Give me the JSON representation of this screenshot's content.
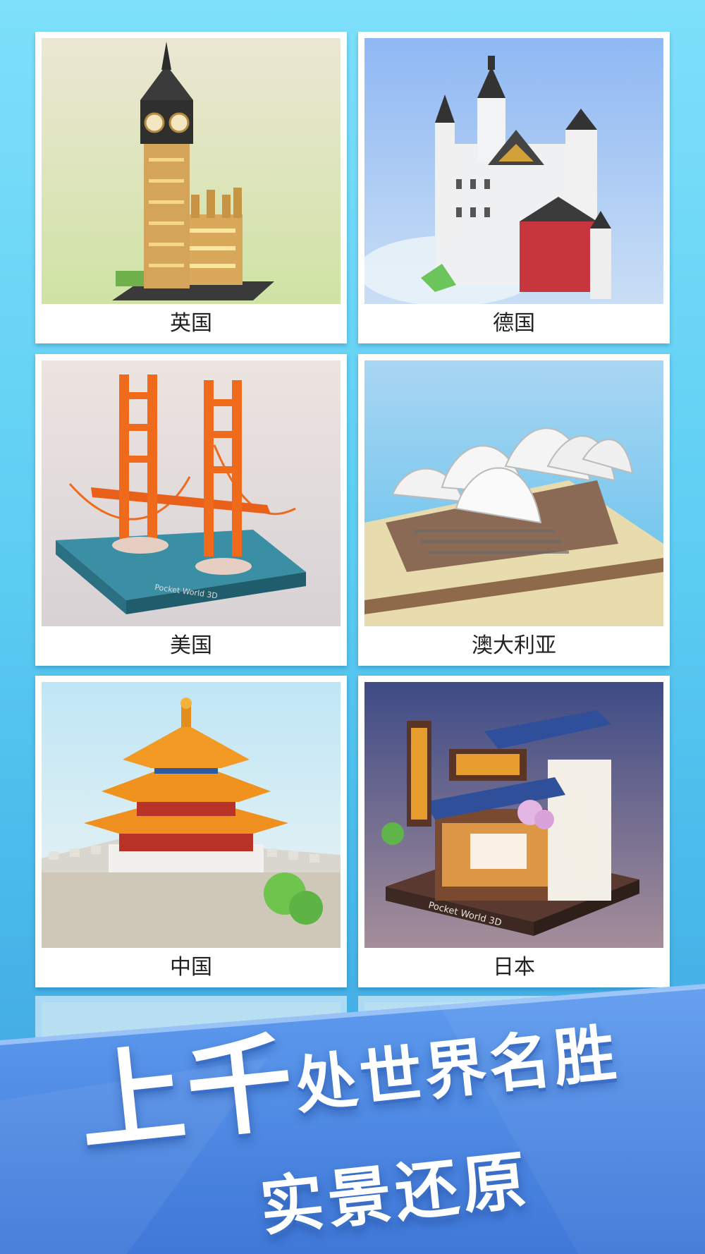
{
  "cards": [
    {
      "label": "英国",
      "image": "big-ben-icon"
    },
    {
      "label": "德国",
      "image": "neuschwanstein-castle-icon"
    },
    {
      "label": "美国",
      "image": "golden-gate-bridge-icon"
    },
    {
      "label": "澳大利亚",
      "image": "sydney-opera-house-icon"
    },
    {
      "label": "中国",
      "image": "forbidden-city-icon"
    },
    {
      "label": "日本",
      "image": "japanese-shop-icon"
    }
  ],
  "model_watermark": "Pocket World 3D",
  "banner": {
    "big_text": "上千",
    "mid_text": "处世界名胜",
    "sub_text": "实景还原"
  },
  "colors": {
    "background_top": "#7ee0fb",
    "banner_blue": "#4a86e0",
    "bridge_orange": "#f06a1c",
    "roof_orange": "#f0921e"
  }
}
